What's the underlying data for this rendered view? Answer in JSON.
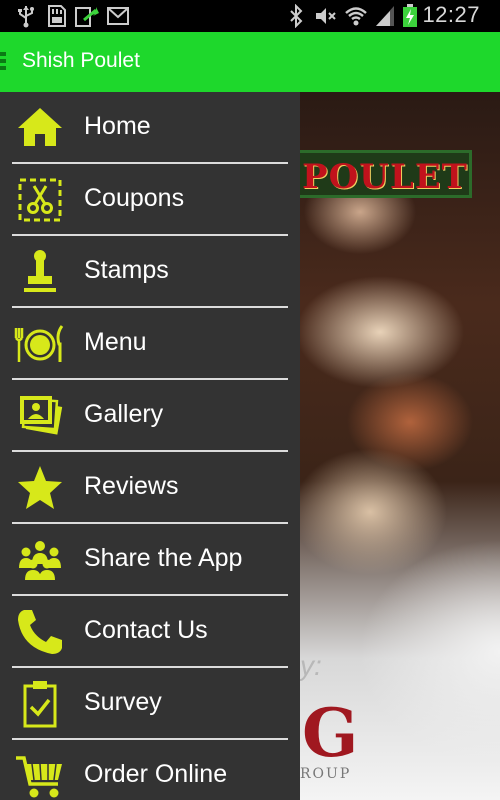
{
  "status_bar": {
    "time": "12:27",
    "left_icons": [
      "usb-icon",
      "sd-card-icon",
      "download-icon",
      "gmail-icon"
    ],
    "right_icons": [
      "bluetooth-icon",
      "mute-icon",
      "wifi-icon",
      "signal-icon",
      "battery-icon"
    ]
  },
  "action_bar": {
    "title": "Shish Poulet"
  },
  "drawer": {
    "icon_color": "#d7e81a",
    "items": [
      {
        "label": "Home",
        "icon": "home-icon"
      },
      {
        "label": "Coupons",
        "icon": "scissors-icon"
      },
      {
        "label": "Stamps",
        "icon": "stamp-icon"
      },
      {
        "label": "Menu",
        "icon": "plate-utensils-icon"
      },
      {
        "label": "Gallery",
        "icon": "photos-icon"
      },
      {
        "label": "Reviews",
        "icon": "star-icon"
      },
      {
        "label": "Share the App",
        "icon": "group-icon"
      },
      {
        "label": "Contact Us",
        "icon": "phone-icon"
      },
      {
        "label": "Survey",
        "icon": "clipboard-check-icon"
      },
      {
        "label": "Order Online",
        "icon": "cart-icon"
      }
    ]
  },
  "background": {
    "sign_text": "POULET",
    "sponsor_by": "y:",
    "sponsor_logo": "G",
    "sponsor_sub": "ROUP"
  },
  "colors": {
    "action_bar": "#1ed82c",
    "drawer_bg": "#333333",
    "icon_accent": "#d7e81a",
    "divider": "#dcdcdc"
  }
}
